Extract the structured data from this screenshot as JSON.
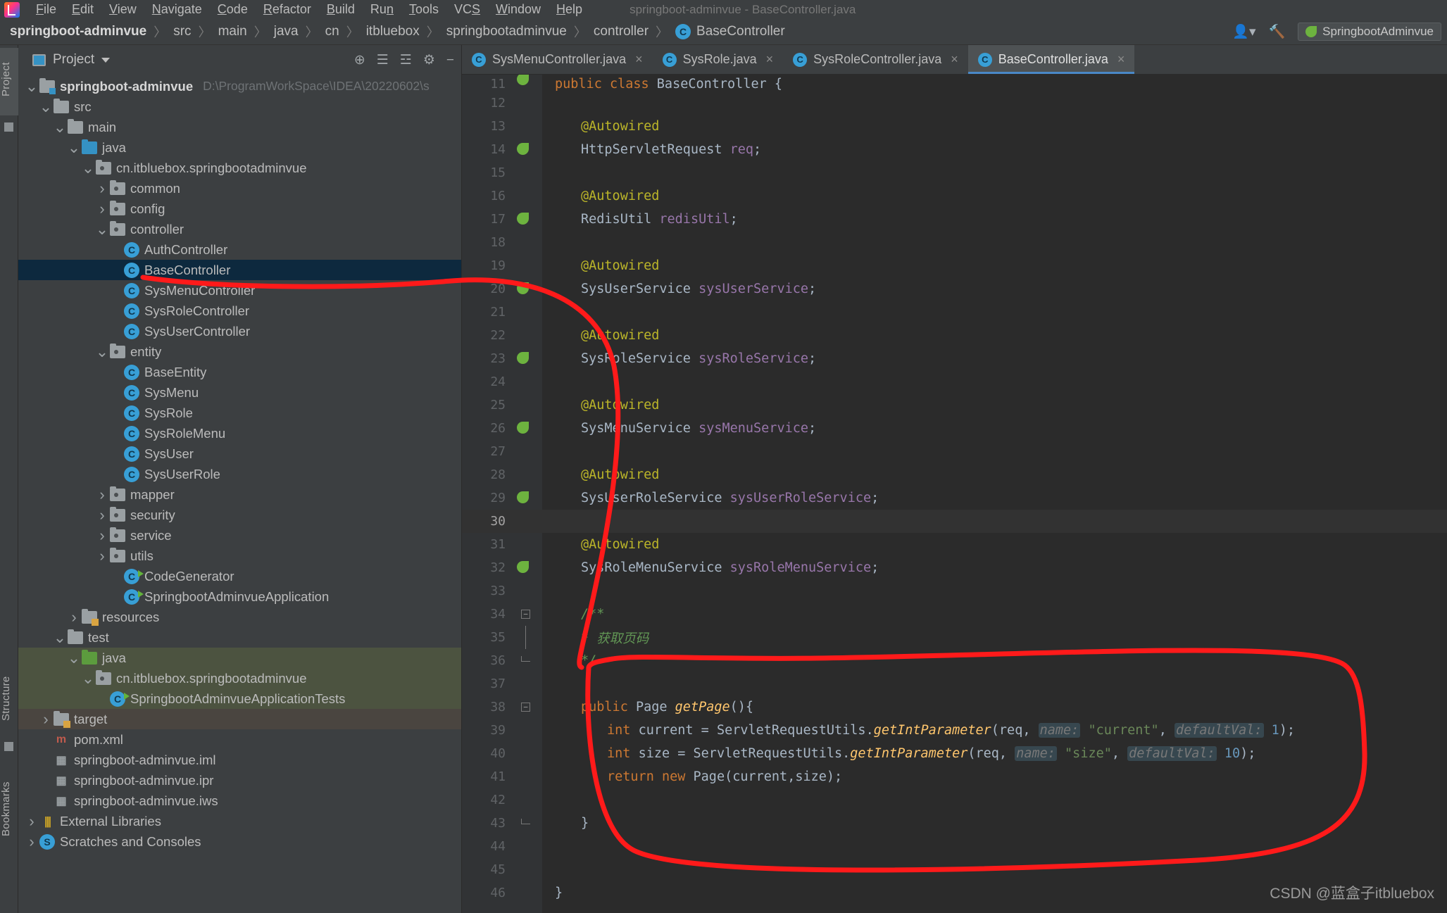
{
  "window": {
    "title": "springboot-adminvue - BaseController.java"
  },
  "menubar": {
    "items": [
      {
        "label": "File",
        "accel": "F"
      },
      {
        "label": "Edit",
        "accel": "E"
      },
      {
        "label": "View",
        "accel": "V"
      },
      {
        "label": "Navigate",
        "accel": "N"
      },
      {
        "label": "Code",
        "accel": "C"
      },
      {
        "label": "Refactor",
        "accel": "R"
      },
      {
        "label": "Build",
        "accel": "B"
      },
      {
        "label": "Run",
        "accel": "n"
      },
      {
        "label": "Tools",
        "accel": "T"
      },
      {
        "label": "VCS",
        "accel": "S"
      },
      {
        "label": "Window",
        "accel": "W"
      },
      {
        "label": "Help",
        "accel": "H"
      }
    ]
  },
  "breadcrumb": {
    "items": [
      "springboot-adminvue",
      "src",
      "main",
      "java",
      "cn",
      "itbluebox",
      "springbootadminvue",
      "controller",
      "BaseController"
    ],
    "last_icon": "class-icon"
  },
  "navbar_right": {
    "avatar_icon": "user-avatar-icon",
    "hammer_icon": "build-hammer-icon",
    "run_config_label": "SpringbootAdminvue",
    "run_config_icon": "spring-leaf-icon"
  },
  "tool_strip": {
    "project": "Project",
    "structure": "Structure",
    "bookmarks": "Bookmarks"
  },
  "project_panel": {
    "title": "Project",
    "view_icon": "project-view-icon",
    "dropdown_icon": "chevron-down-icon",
    "tools": [
      {
        "name": "locate-target-icon",
        "glyph": "⊕"
      },
      {
        "name": "expand-all-icon",
        "glyph": "☰"
      },
      {
        "name": "collapse-all-icon",
        "glyph": "☲"
      },
      {
        "name": "settings-gear-icon",
        "glyph": "⚙"
      },
      {
        "name": "hide-panel-icon",
        "glyph": "−"
      }
    ],
    "tree": [
      {
        "indent": 0,
        "twist": "down",
        "icon": "module-folder",
        "label": "springboot-adminvue",
        "bold": true,
        "path": "D:\\ProgramWorkSpace\\IDEA\\20220602\\s"
      },
      {
        "indent": 1,
        "twist": "down",
        "icon": "folder",
        "label": "src"
      },
      {
        "indent": 2,
        "twist": "down",
        "icon": "folder",
        "label": "main"
      },
      {
        "indent": 3,
        "twist": "down",
        "icon": "source-folder",
        "label": "java"
      },
      {
        "indent": 4,
        "twist": "down",
        "icon": "package",
        "label": "cn.itbluebox.springbootadminvue"
      },
      {
        "indent": 5,
        "twist": "right",
        "icon": "package",
        "label": "common"
      },
      {
        "indent": 5,
        "twist": "right",
        "icon": "package",
        "label": "config"
      },
      {
        "indent": 5,
        "twist": "down",
        "icon": "package",
        "label": "controller"
      },
      {
        "indent": 6,
        "twist": "none",
        "icon": "class",
        "label": "AuthController"
      },
      {
        "indent": 6,
        "twist": "none",
        "icon": "class",
        "label": "BaseController",
        "selected": true
      },
      {
        "indent": 6,
        "twist": "none",
        "icon": "class",
        "label": "SysMenuController"
      },
      {
        "indent": 6,
        "twist": "none",
        "icon": "class",
        "label": "SysRoleController"
      },
      {
        "indent": 6,
        "twist": "none",
        "icon": "class",
        "label": "SysUserController"
      },
      {
        "indent": 5,
        "twist": "down",
        "icon": "package",
        "label": "entity"
      },
      {
        "indent": 6,
        "twist": "none",
        "icon": "class",
        "label": "BaseEntity"
      },
      {
        "indent": 6,
        "twist": "none",
        "icon": "class",
        "label": "SysMenu"
      },
      {
        "indent": 6,
        "twist": "none",
        "icon": "class",
        "label": "SysRole"
      },
      {
        "indent": 6,
        "twist": "none",
        "icon": "class",
        "label": "SysRoleMenu"
      },
      {
        "indent": 6,
        "twist": "none",
        "icon": "class",
        "label": "SysUser"
      },
      {
        "indent": 6,
        "twist": "none",
        "icon": "class",
        "label": "SysUserRole"
      },
      {
        "indent": 5,
        "twist": "right",
        "icon": "package",
        "label": "mapper"
      },
      {
        "indent": 5,
        "twist": "right",
        "icon": "package",
        "label": "security"
      },
      {
        "indent": 5,
        "twist": "right",
        "icon": "package",
        "label": "service"
      },
      {
        "indent": 5,
        "twist": "right",
        "icon": "package",
        "label": "utils"
      },
      {
        "indent": 6,
        "twist": "none",
        "icon": "class-runnable",
        "label": "CodeGenerator"
      },
      {
        "indent": 6,
        "twist": "none",
        "icon": "class-spring",
        "label": "SpringbootAdminvueApplication"
      },
      {
        "indent": 3,
        "twist": "right",
        "icon": "resource-folder",
        "label": "resources"
      },
      {
        "indent": 2,
        "twist": "down",
        "icon": "folder",
        "label": "test"
      },
      {
        "indent": 3,
        "twist": "down",
        "icon": "test-source-folder",
        "label": "java",
        "bg": "green"
      },
      {
        "indent": 4,
        "twist": "down",
        "icon": "package",
        "label": "cn.itbluebox.springbootadminvue",
        "bg": "green"
      },
      {
        "indent": 5,
        "twist": "none",
        "icon": "class-spring",
        "label": "SpringbootAdminvueApplicationTests",
        "bg": "green"
      },
      {
        "indent": 1,
        "twist": "right",
        "icon": "target-folder",
        "label": "target",
        "bg": "brown"
      },
      {
        "indent": 1,
        "twist": "none",
        "icon": "maven",
        "label": "pom.xml"
      },
      {
        "indent": 1,
        "twist": "none",
        "icon": "iml",
        "label": "springboot-adminvue.iml"
      },
      {
        "indent": 1,
        "twist": "none",
        "icon": "iml",
        "label": "springboot-adminvue.ipr"
      },
      {
        "indent": 1,
        "twist": "none",
        "icon": "iml",
        "label": "springboot-adminvue.iws"
      },
      {
        "indent": 0,
        "twist": "right",
        "icon": "library",
        "label": "External Libraries"
      },
      {
        "indent": 0,
        "twist": "right",
        "icon": "scratch",
        "label": "Scratches and Consoles"
      }
    ]
  },
  "editor": {
    "tabs": [
      {
        "label": "SysMenuController.java",
        "active": false,
        "closable": true
      },
      {
        "label": "SysRole.java",
        "active": false,
        "closable": true
      },
      {
        "label": "SysRoleController.java",
        "active": false,
        "closable": true
      },
      {
        "label": "BaseController.java",
        "active": true,
        "closable": true
      }
    ],
    "current_line": 30,
    "code": [
      {
        "n": 11,
        "gutter": "bean-override",
        "fold": "none",
        "tokens": [
          {
            "t": "public ",
            "c": "k"
          },
          {
            "t": "class ",
            "c": "k"
          },
          {
            "t": "BaseController ",
            "c": "pl"
          },
          {
            "t": "{",
            "c": "pl"
          }
        ],
        "indent": 0,
        "partial_top": true
      },
      {
        "n": 12,
        "gutter": "",
        "fold": "none",
        "tokens": []
      },
      {
        "n": 13,
        "gutter": "",
        "fold": "none",
        "indent": 1,
        "tokens": [
          {
            "t": "@Autowired",
            "c": "ann"
          }
        ]
      },
      {
        "n": 14,
        "gutter": "bean",
        "fold": "none",
        "indent": 1,
        "tokens": [
          {
            "t": "HttpServletRequest ",
            "c": "pl"
          },
          {
            "t": "req",
            "c": "fld"
          },
          {
            "t": ";",
            "c": "pl"
          }
        ]
      },
      {
        "n": 15,
        "gutter": "",
        "fold": "none",
        "tokens": []
      },
      {
        "n": 16,
        "gutter": "",
        "fold": "none",
        "indent": 1,
        "tokens": [
          {
            "t": "@Autowired",
            "c": "ann"
          }
        ]
      },
      {
        "n": 17,
        "gutter": "bean",
        "fold": "none",
        "indent": 1,
        "tokens": [
          {
            "t": "RedisUtil ",
            "c": "pl"
          },
          {
            "t": "redisUtil",
            "c": "fld"
          },
          {
            "t": ";",
            "c": "pl"
          }
        ]
      },
      {
        "n": 18,
        "gutter": "",
        "fold": "none",
        "tokens": []
      },
      {
        "n": 19,
        "gutter": "",
        "fold": "none",
        "indent": 1,
        "tokens": [
          {
            "t": "@Autowired",
            "c": "ann"
          }
        ]
      },
      {
        "n": 20,
        "gutter": "bean",
        "fold": "none",
        "indent": 1,
        "tokens": [
          {
            "t": "SysUserService ",
            "c": "pl"
          },
          {
            "t": "sysUserService",
            "c": "fld"
          },
          {
            "t": ";",
            "c": "pl"
          }
        ]
      },
      {
        "n": 21,
        "gutter": "",
        "fold": "none",
        "tokens": []
      },
      {
        "n": 22,
        "gutter": "",
        "fold": "none",
        "indent": 1,
        "tokens": [
          {
            "t": "@Autowired",
            "c": "ann"
          }
        ]
      },
      {
        "n": 23,
        "gutter": "bean",
        "fold": "none",
        "indent": 1,
        "tokens": [
          {
            "t": "SysRoleService ",
            "c": "pl"
          },
          {
            "t": "sysRoleService",
            "c": "fld"
          },
          {
            "t": ";",
            "c": "pl"
          }
        ]
      },
      {
        "n": 24,
        "gutter": "",
        "fold": "none",
        "tokens": []
      },
      {
        "n": 25,
        "gutter": "",
        "fold": "none",
        "indent": 1,
        "tokens": [
          {
            "t": "@Autowired",
            "c": "ann"
          }
        ]
      },
      {
        "n": 26,
        "gutter": "bean",
        "fold": "none",
        "indent": 1,
        "tokens": [
          {
            "t": "SysMenuService ",
            "c": "pl"
          },
          {
            "t": "sysMenuService",
            "c": "fld"
          },
          {
            "t": ";",
            "c": "pl"
          }
        ]
      },
      {
        "n": 27,
        "gutter": "",
        "fold": "none",
        "tokens": []
      },
      {
        "n": 28,
        "gutter": "",
        "fold": "none",
        "indent": 1,
        "tokens": [
          {
            "t": "@Autowired",
            "c": "ann"
          }
        ]
      },
      {
        "n": 29,
        "gutter": "bean",
        "fold": "none",
        "indent": 1,
        "tokens": [
          {
            "t": "SysUserRoleService ",
            "c": "pl"
          },
          {
            "t": "sysUserRoleService",
            "c": "fld"
          },
          {
            "t": ";",
            "c": "pl"
          }
        ]
      },
      {
        "n": 30,
        "gutter": "",
        "fold": "none",
        "current": true,
        "tokens": []
      },
      {
        "n": 31,
        "gutter": "",
        "fold": "none",
        "indent": 1,
        "tokens": [
          {
            "t": "@Autowired",
            "c": "ann"
          }
        ]
      },
      {
        "n": 32,
        "gutter": "bean",
        "fold": "none",
        "indent": 1,
        "tokens": [
          {
            "t": "SysRoleMenuService ",
            "c": "pl"
          },
          {
            "t": "sysRoleMenuService",
            "c": "fld"
          },
          {
            "t": ";",
            "c": "pl"
          }
        ]
      },
      {
        "n": 33,
        "gutter": "",
        "fold": "none",
        "tokens": []
      },
      {
        "n": 34,
        "gutter": "",
        "fold": "minus",
        "indent": 1,
        "tokens": [
          {
            "t": "/**",
            "c": "cmt"
          }
        ]
      },
      {
        "n": 35,
        "gutter": "",
        "fold": "line",
        "indent": 1,
        "tokens": [
          {
            "t": "* ",
            "c": "cmt"
          },
          {
            "t": "获取页码",
            "c": "cmt"
          }
        ]
      },
      {
        "n": 36,
        "gutter": "",
        "fold": "end",
        "indent": 1,
        "tokens": [
          {
            "t": "*/",
            "c": "cmt"
          }
        ]
      },
      {
        "n": 37,
        "gutter": "",
        "fold": "none",
        "tokens": []
      },
      {
        "n": 38,
        "gutter": "",
        "fold": "minus",
        "indent": 1,
        "tokens": [
          {
            "t": "public ",
            "c": "k"
          },
          {
            "t": "Page ",
            "c": "pl"
          },
          {
            "t": "getPage",
            "c": "mth"
          },
          {
            "t": "(){",
            "c": "pl"
          }
        ]
      },
      {
        "n": 39,
        "gutter": "",
        "fold": "none",
        "indent": 2,
        "tokens": [
          {
            "t": "int ",
            "c": "k"
          },
          {
            "t": "current = ServletRequestUtils.",
            "c": "pl"
          },
          {
            "t": "getIntParameter",
            "c": "mth"
          },
          {
            "t": "(req, ",
            "c": "pl"
          },
          {
            "t": "name:",
            "c": "hint"
          },
          {
            "t": " ",
            "c": "pl"
          },
          {
            "t": "\"current\"",
            "c": "str"
          },
          {
            "t": ", ",
            "c": "pl"
          },
          {
            "t": "defaultVal:",
            "c": "hint"
          },
          {
            "t": " ",
            "c": "pl"
          },
          {
            "t": "1",
            "c": "num"
          },
          {
            "t": ");",
            "c": "pl"
          }
        ]
      },
      {
        "n": 40,
        "gutter": "",
        "fold": "none",
        "indent": 2,
        "tokens": [
          {
            "t": "int ",
            "c": "k"
          },
          {
            "t": "size = ServletRequestUtils.",
            "c": "pl"
          },
          {
            "t": "getIntParameter",
            "c": "mth"
          },
          {
            "t": "(req, ",
            "c": "pl"
          },
          {
            "t": "name:",
            "c": "hint"
          },
          {
            "t": " ",
            "c": "pl"
          },
          {
            "t": "\"size\"",
            "c": "str"
          },
          {
            "t": ", ",
            "c": "pl"
          },
          {
            "t": "defaultVal:",
            "c": "hint"
          },
          {
            "t": " ",
            "c": "pl"
          },
          {
            "t": "10",
            "c": "num"
          },
          {
            "t": ");",
            "c": "pl"
          }
        ]
      },
      {
        "n": 41,
        "gutter": "",
        "fold": "none",
        "indent": 2,
        "tokens": [
          {
            "t": "return ",
            "c": "k"
          },
          {
            "t": "new ",
            "c": "k"
          },
          {
            "t": "Page",
            "c": "pl"
          },
          {
            "t": "(current,size);",
            "c": "pl"
          }
        ]
      },
      {
        "n": 42,
        "gutter": "",
        "fold": "none",
        "tokens": []
      },
      {
        "n": 43,
        "gutter": "",
        "fold": "end",
        "indent": 1,
        "tokens": [
          {
            "t": "}",
            "c": "pl"
          }
        ]
      },
      {
        "n": 44,
        "gutter": "",
        "fold": "none",
        "tokens": []
      },
      {
        "n": 45,
        "gutter": "",
        "fold": "none",
        "tokens": []
      },
      {
        "n": 46,
        "gutter": "",
        "fold": "none",
        "indent": 0,
        "tokens": [
          {
            "t": "}",
            "c": "pl"
          }
        ]
      }
    ]
  },
  "annotations": {
    "stroke_color": "#ff1a1a",
    "marks": [
      {
        "name": "underline-basecontroller-tree-item"
      },
      {
        "name": "connector-curve"
      },
      {
        "name": "circle-getpage-method"
      }
    ]
  },
  "watermark": {
    "text": "CSDN @蓝盒子itbluebox",
    "color": "#9a9a9a"
  }
}
